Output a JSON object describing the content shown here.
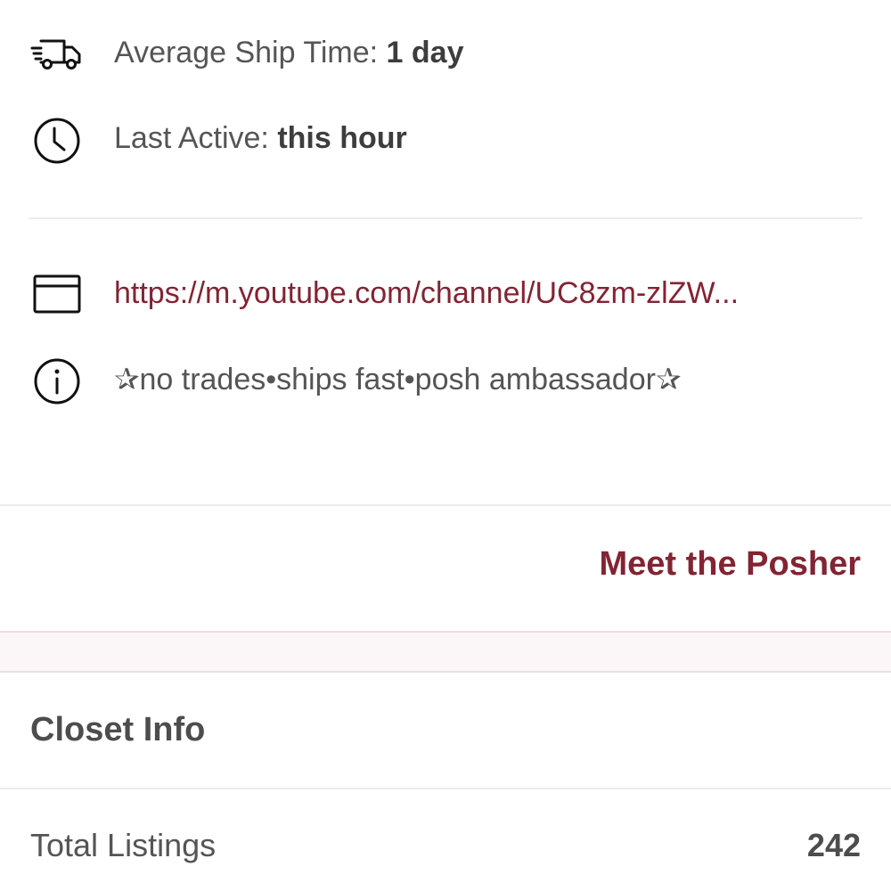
{
  "seller_stats": {
    "ship_time_label": "Average Ship Time: ",
    "ship_time_value": "1 day",
    "last_active_label": "Last Active: ",
    "last_active_value": "this hour"
  },
  "bio": {
    "website_url": "https://m.youtube.com/channel/UC8zm-zlZW...",
    "description": "✰no trades•ships fast•posh ambassador✰"
  },
  "actions": {
    "meet_posher_label": "Meet the Posher"
  },
  "closet_info": {
    "title": "Closet Info",
    "total_listings_label": "Total Listings",
    "total_listings_value": "242"
  },
  "colors": {
    "accent": "#822433",
    "text": "#555555"
  },
  "icons": {
    "ship": "truck-icon",
    "active": "clock-icon",
    "website": "browser-window-icon",
    "bio": "info-icon"
  }
}
